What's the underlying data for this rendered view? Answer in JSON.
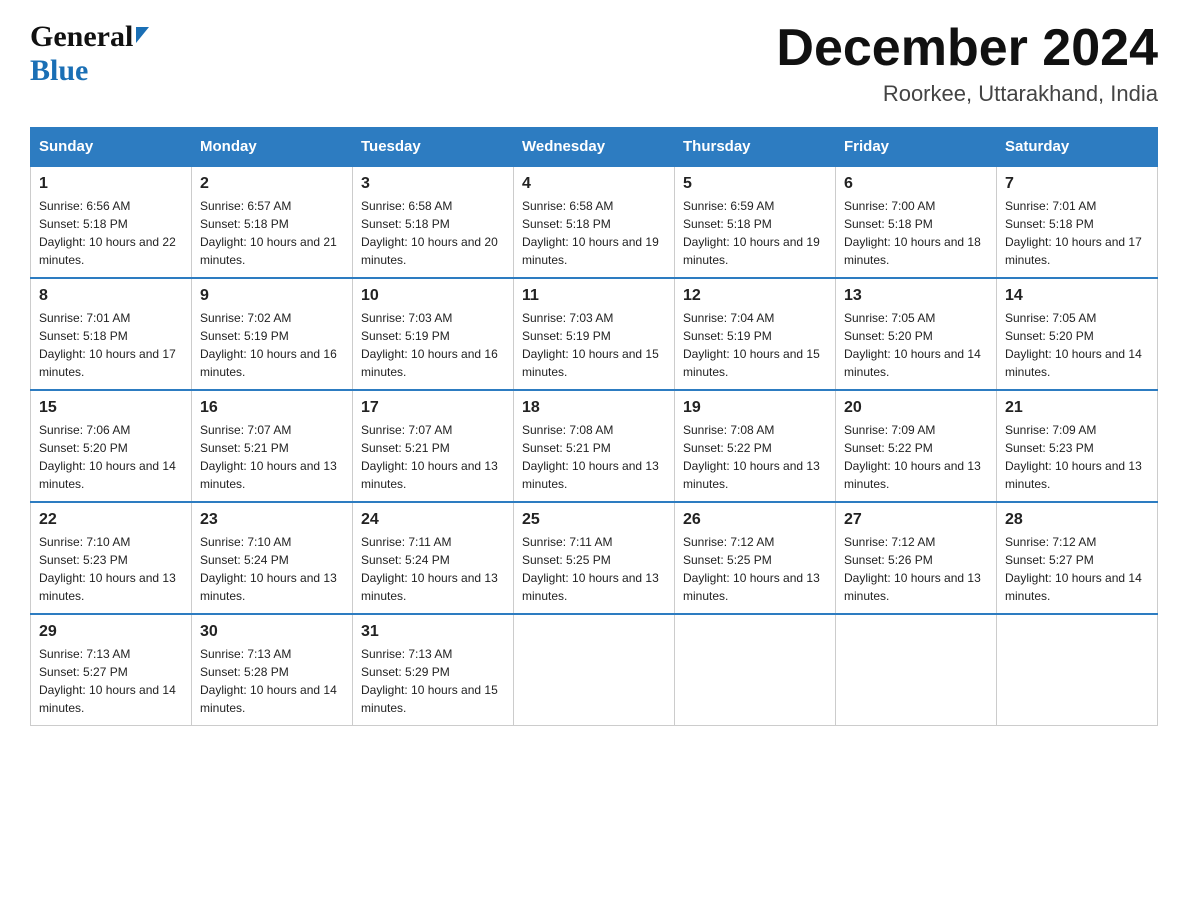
{
  "logo": {
    "general": "General",
    "blue": "Blue"
  },
  "header": {
    "month": "December 2024",
    "location": "Roorkee, Uttarakhand, India"
  },
  "days_of_week": [
    "Sunday",
    "Monday",
    "Tuesday",
    "Wednesday",
    "Thursday",
    "Friday",
    "Saturday"
  ],
  "weeks": [
    [
      {
        "day": "1",
        "sunrise": "6:56 AM",
        "sunset": "5:18 PM",
        "daylight": "10 hours and 22 minutes."
      },
      {
        "day": "2",
        "sunrise": "6:57 AM",
        "sunset": "5:18 PM",
        "daylight": "10 hours and 21 minutes."
      },
      {
        "day": "3",
        "sunrise": "6:58 AM",
        "sunset": "5:18 PM",
        "daylight": "10 hours and 20 minutes."
      },
      {
        "day": "4",
        "sunrise": "6:58 AM",
        "sunset": "5:18 PM",
        "daylight": "10 hours and 19 minutes."
      },
      {
        "day": "5",
        "sunrise": "6:59 AM",
        "sunset": "5:18 PM",
        "daylight": "10 hours and 19 minutes."
      },
      {
        "day": "6",
        "sunrise": "7:00 AM",
        "sunset": "5:18 PM",
        "daylight": "10 hours and 18 minutes."
      },
      {
        "day": "7",
        "sunrise": "7:01 AM",
        "sunset": "5:18 PM",
        "daylight": "10 hours and 17 minutes."
      }
    ],
    [
      {
        "day": "8",
        "sunrise": "7:01 AM",
        "sunset": "5:18 PM",
        "daylight": "10 hours and 17 minutes."
      },
      {
        "day": "9",
        "sunrise": "7:02 AM",
        "sunset": "5:19 PM",
        "daylight": "10 hours and 16 minutes."
      },
      {
        "day": "10",
        "sunrise": "7:03 AM",
        "sunset": "5:19 PM",
        "daylight": "10 hours and 16 minutes."
      },
      {
        "day": "11",
        "sunrise": "7:03 AM",
        "sunset": "5:19 PM",
        "daylight": "10 hours and 15 minutes."
      },
      {
        "day": "12",
        "sunrise": "7:04 AM",
        "sunset": "5:19 PM",
        "daylight": "10 hours and 15 minutes."
      },
      {
        "day": "13",
        "sunrise": "7:05 AM",
        "sunset": "5:20 PM",
        "daylight": "10 hours and 14 minutes."
      },
      {
        "day": "14",
        "sunrise": "7:05 AM",
        "sunset": "5:20 PM",
        "daylight": "10 hours and 14 minutes."
      }
    ],
    [
      {
        "day": "15",
        "sunrise": "7:06 AM",
        "sunset": "5:20 PM",
        "daylight": "10 hours and 14 minutes."
      },
      {
        "day": "16",
        "sunrise": "7:07 AM",
        "sunset": "5:21 PM",
        "daylight": "10 hours and 13 minutes."
      },
      {
        "day": "17",
        "sunrise": "7:07 AM",
        "sunset": "5:21 PM",
        "daylight": "10 hours and 13 minutes."
      },
      {
        "day": "18",
        "sunrise": "7:08 AM",
        "sunset": "5:21 PM",
        "daylight": "10 hours and 13 minutes."
      },
      {
        "day": "19",
        "sunrise": "7:08 AM",
        "sunset": "5:22 PM",
        "daylight": "10 hours and 13 minutes."
      },
      {
        "day": "20",
        "sunrise": "7:09 AM",
        "sunset": "5:22 PM",
        "daylight": "10 hours and 13 minutes."
      },
      {
        "day": "21",
        "sunrise": "7:09 AM",
        "sunset": "5:23 PM",
        "daylight": "10 hours and 13 minutes."
      }
    ],
    [
      {
        "day": "22",
        "sunrise": "7:10 AM",
        "sunset": "5:23 PM",
        "daylight": "10 hours and 13 minutes."
      },
      {
        "day": "23",
        "sunrise": "7:10 AM",
        "sunset": "5:24 PM",
        "daylight": "10 hours and 13 minutes."
      },
      {
        "day": "24",
        "sunrise": "7:11 AM",
        "sunset": "5:24 PM",
        "daylight": "10 hours and 13 minutes."
      },
      {
        "day": "25",
        "sunrise": "7:11 AM",
        "sunset": "5:25 PM",
        "daylight": "10 hours and 13 minutes."
      },
      {
        "day": "26",
        "sunrise": "7:12 AM",
        "sunset": "5:25 PM",
        "daylight": "10 hours and 13 minutes."
      },
      {
        "day": "27",
        "sunrise": "7:12 AM",
        "sunset": "5:26 PM",
        "daylight": "10 hours and 13 minutes."
      },
      {
        "day": "28",
        "sunrise": "7:12 AM",
        "sunset": "5:27 PM",
        "daylight": "10 hours and 14 minutes."
      }
    ],
    [
      {
        "day": "29",
        "sunrise": "7:13 AM",
        "sunset": "5:27 PM",
        "daylight": "10 hours and 14 minutes."
      },
      {
        "day": "30",
        "sunrise": "7:13 AM",
        "sunset": "5:28 PM",
        "daylight": "10 hours and 14 minutes."
      },
      {
        "day": "31",
        "sunrise": "7:13 AM",
        "sunset": "5:29 PM",
        "daylight": "10 hours and 15 minutes."
      },
      null,
      null,
      null,
      null
    ]
  ]
}
